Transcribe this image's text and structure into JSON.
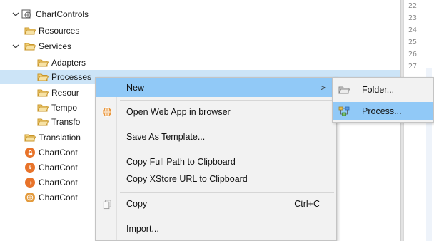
{
  "tree": {
    "root": {
      "label": "ChartControls",
      "icon": "project-globe-icon"
    },
    "items": [
      {
        "label": "Resources",
        "icon": "folder-icon"
      },
      {
        "label": "Services",
        "icon": "folder-icon"
      },
      {
        "label": "Adapters",
        "icon": "folder-icon"
      },
      {
        "label": "Processes",
        "icon": "folder-icon"
      },
      {
        "label": "Resour",
        "icon": "folder-icon"
      },
      {
        "label": "Tempo",
        "icon": "folder-icon"
      },
      {
        "label": "Transfo",
        "icon": "folder-icon"
      },
      {
        "label": "Translation",
        "icon": "folder-icon"
      },
      {
        "label": "ChartCont",
        "icon": "lock-icon"
      },
      {
        "label": "ChartCont",
        "icon": "section-icon"
      },
      {
        "label": "ChartCont",
        "icon": "export-icon"
      },
      {
        "label": "ChartCont",
        "icon": "globe-icon"
      }
    ]
  },
  "editor": {
    "line_numbers": [
      "22",
      "23",
      "24",
      "25",
      "26",
      "27"
    ]
  },
  "context_menu": {
    "new": "New",
    "open_web_app": "Open Web App in browser",
    "save_template": "Save As Template...",
    "copy_full_path": "Copy Full Path to Clipboard",
    "copy_xstore": "Copy XStore URL to Clipboard",
    "copy": "Copy",
    "copy_shortcut": "Ctrl+C",
    "import": "Import...",
    "submenu_arrow": ">"
  },
  "submenu": {
    "folder": "Folder...",
    "process": "Process..."
  },
  "colors": {
    "selection": "#cce4f7",
    "menu_highlight": "#91c9f7",
    "folder": "#e8b94a",
    "lock": "#e8732a",
    "section": "#e8732a",
    "export": "#e8732a"
  }
}
